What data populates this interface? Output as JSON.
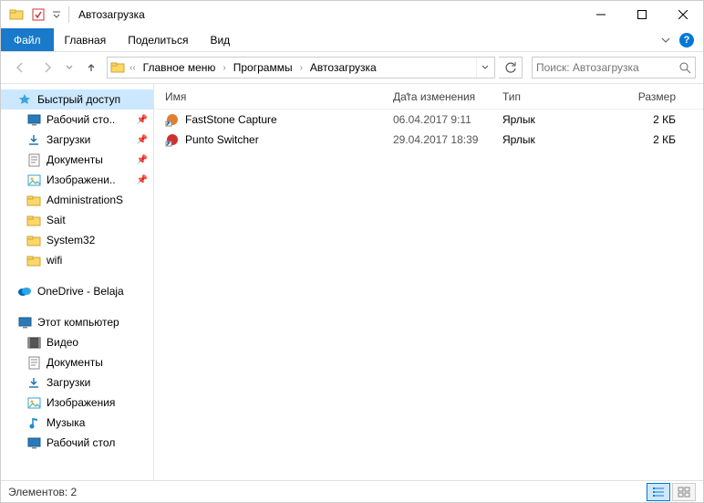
{
  "title": "Автозагрузка",
  "menu": {
    "file": "Файл",
    "home": "Главная",
    "share": "Поделиться",
    "view": "Вид"
  },
  "breadcrumbs": [
    "Главное меню",
    "Программы",
    "Автозагрузка"
  ],
  "search_placeholder": "Поиск: Автозагрузка",
  "columns": {
    "name": "Имя",
    "date": "Дата изменения",
    "type": "Тип",
    "size": "Размер"
  },
  "files": [
    {
      "name": "FastStone Capture",
      "date": "06.04.2017 9:11",
      "type": "Ярлык",
      "size": "2 КБ",
      "iconColor": "#e08030"
    },
    {
      "name": "Punto Switcher",
      "date": "29.04.2017 18:39",
      "type": "Ярлык",
      "size": "2 КБ",
      "iconColor": "#d03030"
    }
  ],
  "sidebar": {
    "quick": "Быстрый доступ",
    "items": [
      {
        "label": "Рабочий сто..",
        "icon": "desktop",
        "pin": true
      },
      {
        "label": "Загрузки",
        "icon": "download",
        "pin": true
      },
      {
        "label": "Документы",
        "icon": "doc",
        "pin": true
      },
      {
        "label": "Изображени..",
        "icon": "image",
        "pin": true
      },
      {
        "label": "AdministrationS",
        "icon": "folder",
        "pin": false
      },
      {
        "label": "Sait",
        "icon": "folder",
        "pin": false
      },
      {
        "label": "System32",
        "icon": "folder",
        "pin": false
      },
      {
        "label": "wifi",
        "icon": "folder",
        "pin": false
      }
    ],
    "onedrive": "OneDrive - Belaja",
    "thispc": "Этот компьютер",
    "pcitems": [
      {
        "label": "Видео",
        "icon": "video"
      },
      {
        "label": "Документы",
        "icon": "doc"
      },
      {
        "label": "Загрузки",
        "icon": "download"
      },
      {
        "label": "Изображения",
        "icon": "image"
      },
      {
        "label": "Музыка",
        "icon": "music"
      },
      {
        "label": "Рабочий стол",
        "icon": "desktop"
      }
    ]
  },
  "status": "Элементов: 2"
}
